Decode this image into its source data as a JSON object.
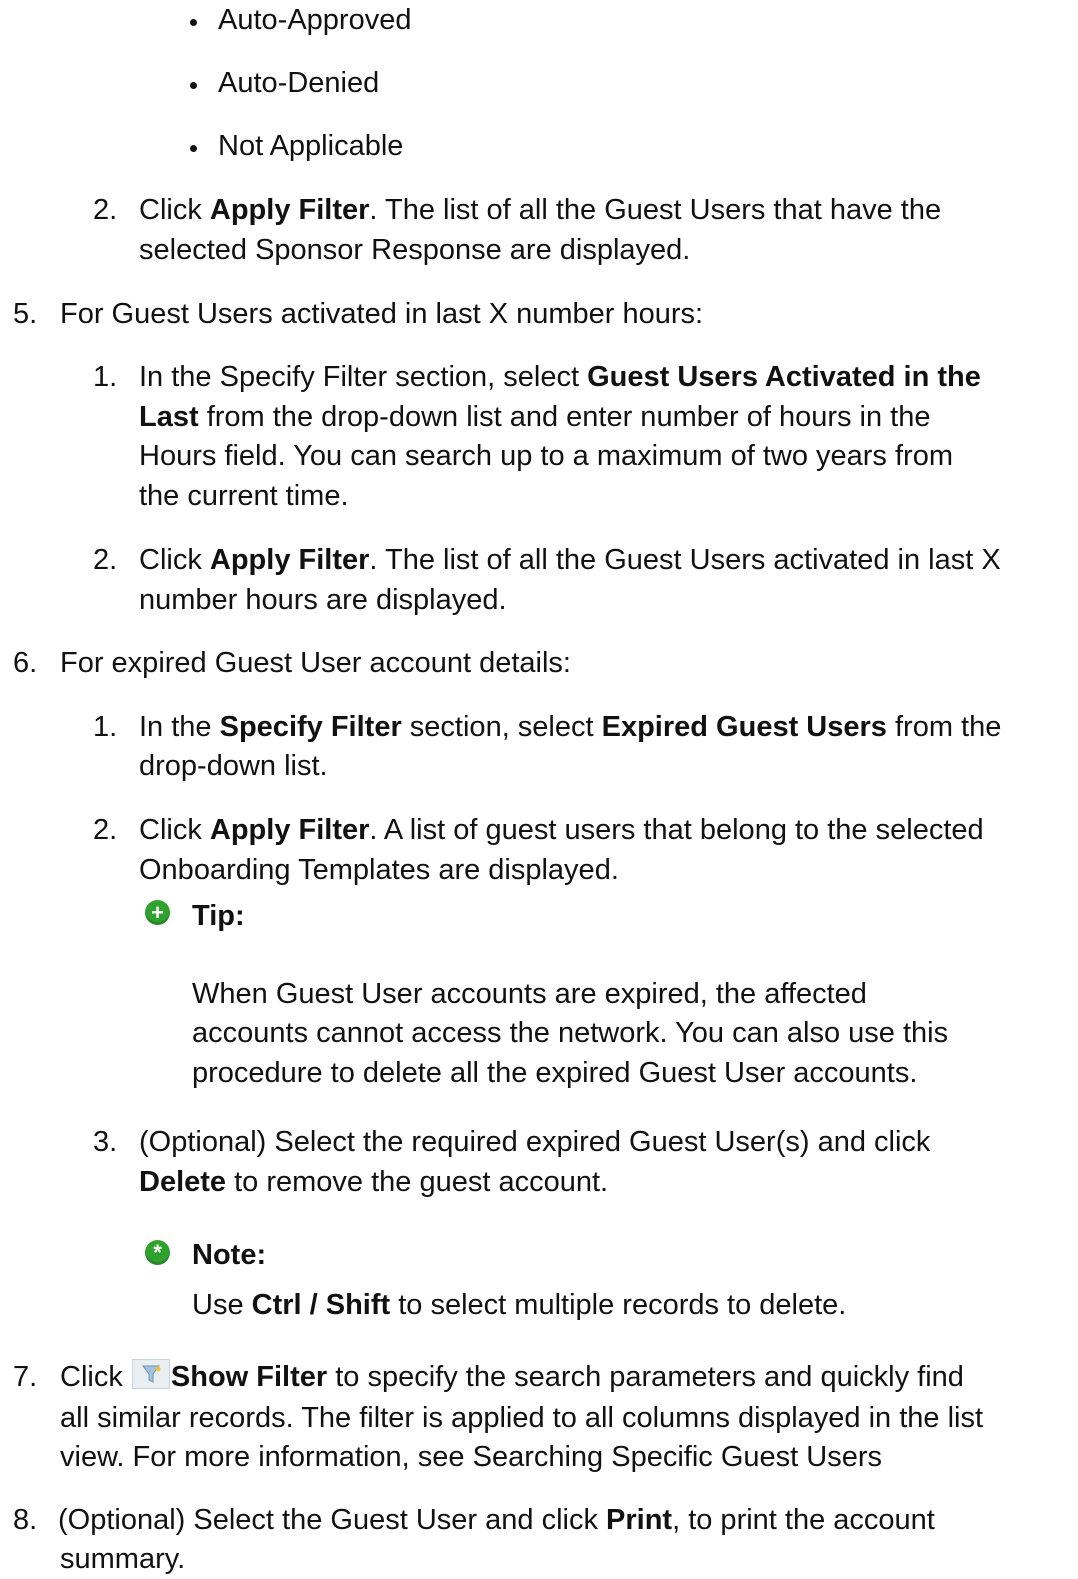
{
  "bullets": [
    "Auto-Approved",
    "Auto-Denied",
    "Not Applicable"
  ],
  "s4_step2": {
    "num": "2.",
    "l1_a": "Click ",
    "l1_b": "Apply Filter",
    "l1_c": ". The list of all the Guest Users that have the",
    "l2": "selected Sponsor Response are displayed."
  },
  "s5": {
    "num": "5.",
    "head": "For Guest Users activated in last X number hours:",
    "st1": {
      "num": "1.",
      "l1_a": "In the Specify Filter section, select ",
      "l1_b": "Guest Users Activated in the",
      "l2_a": "Last",
      "l2_b": " from the drop-down list and enter number of hours in the",
      "l3": "Hours field. You can search up to a maximum of two years from",
      "l4": "the current time."
    },
    "st2": {
      "num": "2.",
      "l1_a": "Click ",
      "l1_b": "Apply Filter",
      "l1_c": ". The list of all the Guest Users activated in last X",
      "l2": "number hours are displayed."
    }
  },
  "s6": {
    "num": "6.",
    "head": "For expired Guest User account details:",
    "st1": {
      "num": "1.",
      "l1_a": "In the ",
      "l1_b": "Specify Filter",
      "l1_c": " section, select ",
      "l1_d": "Expired Guest Users",
      "l1_e": " from the",
      "l2": "drop-down list."
    },
    "st2": {
      "num": "2.",
      "l1_a": "Click ",
      "l1_b": "Apply Filter",
      "l1_c": ". A list of guest users that belong to the selected",
      "l2": "Onboarding Templates are displayed."
    },
    "tip": {
      "label": "Tip:",
      "l1": "When Guest User accounts are expired, the affected",
      "l2": "accounts cannot access the network. You can also use this",
      "l3": "procedure to delete all the expired Guest User accounts."
    },
    "st3": {
      "num": "3.",
      "l1": "(Optional) Select the required expired Guest User(s) and click",
      "l2_a": "Delete",
      "l2_b": " to remove the guest account."
    },
    "note": {
      "label": "Note:",
      "l1_a": "Use ",
      "l1_b": "Ctrl / Shift",
      "l1_c": " to select multiple records to delete."
    }
  },
  "s7": {
    "num": "7.",
    "l1_a": "Click ",
    "l1_b": "Show Filter",
    "l1_c": " to specify the search parameters and quickly find",
    "l2": "all similar records. The filter is applied to all columns displayed in the list",
    "l3": "view. For more information, see Searching Specific Guest Users"
  },
  "s8": {
    "num": "8.",
    "l1_a": " (Optional) Select the Guest User and click ",
    "l1_b": "Print",
    "l1_c": ", to print the account",
    "l2": "summary."
  },
  "icons": {
    "tip": "plus-circle-icon",
    "note": "asterisk-circle-icon",
    "filter": "filter-funnel-icon"
  },
  "colors": {
    "icon_green": "#2fa12f",
    "text": "#111111"
  }
}
